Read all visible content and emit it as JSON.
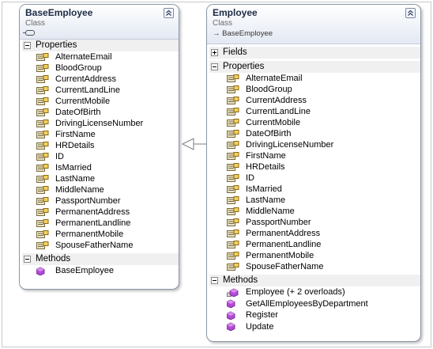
{
  "base_class": {
    "name": "BaseEmployee",
    "stereotype": "Class",
    "icon": "interface-lollipop-icon",
    "properties_label": "Properties",
    "properties": [
      "AlternateEmail",
      "BloodGroup",
      "CurrentAddress",
      "CurrentLandLine",
      "CurrentMobile",
      "DateOfBirth",
      "DrivingLicenseNumber",
      "FirstName",
      "HRDetails",
      "ID",
      "IsMarried",
      "LastName",
      "MiddleName",
      "PassportNumber",
      "PermanentAddress",
      "PermanentLandline",
      "PermanentMobile",
      "SpouseFatherName"
    ],
    "methods_label": "Methods",
    "methods": [
      "BaseEmployee"
    ]
  },
  "derived_class": {
    "name": "Employee",
    "stereotype": "Class",
    "base_ref": "→ BaseEmployee",
    "fields_label": "Fields",
    "properties_label": "Properties",
    "properties": [
      "AlternateEmail",
      "BloodGroup",
      "CurrentAddress",
      "CurrentLandLine",
      "CurrentMobile",
      "DateOfBirth",
      "DrivingLicenseNumber",
      "FirstName",
      "HRDetails",
      "ID",
      "IsMarried",
      "LastName",
      "MiddleName",
      "PassportNumber",
      "PermanentAddress",
      "PermanentLandline",
      "PermanentMobile",
      "SpouseFatherName"
    ],
    "methods_label": "Methods",
    "methods": [
      "Employee (+ 2 overloads)",
      "GetAllEmployeesByDepartment",
      "Register",
      "Update"
    ]
  },
  "colors": {
    "header_gradient_end": "#e3e9f3",
    "border": "#8b97a8",
    "section_band": "#f0f0f0",
    "method_icon": "#b14bd6"
  }
}
